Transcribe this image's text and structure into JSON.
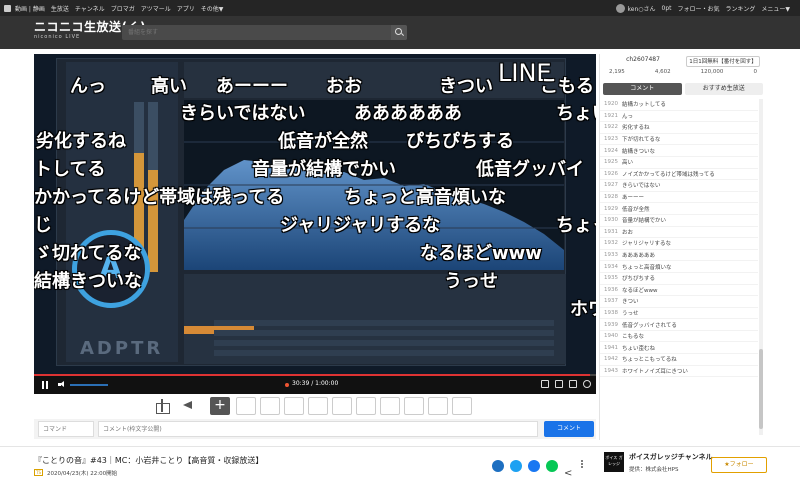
{
  "topbar": {
    "nav": [
      "動画 | 静画",
      "生放送",
      "チャンネル",
      "ブロマガ",
      "アツマール",
      "アプリ",
      "その他▼"
    ],
    "user": "ken○さん",
    "points": "0pt",
    "right_links": [
      "フォロー・お気",
      "ランキング",
      "メニュー▼"
    ]
  },
  "header": {
    "logo_main": "ニコニコ生放送(く)",
    "logo_sub": "niconico LIVE",
    "search_placeholder": "番組を探す"
  },
  "danmaku": [
    "んっ",
    "高い",
    "あーーー",
    "おお",
    "きつい",
    "LINE",
    "こもる",
    "きらいではない",
    "ああああああ",
    "ちょい",
    "劣化するね",
    "低音が全然",
    "ぴちぴちする",
    "トしてる",
    "音量が結構でかい",
    "低音グッバイ",
    "かかってるけど帯域は残ってる",
    "ちょっと高音煩いな",
    "じ",
    "ジャリジャリするな",
    "ちょっ",
    "ゞ切れてるな",
    "なるほどwww",
    "結構きついな",
    "うっせ",
    "ホワ"
  ],
  "player": {
    "time": "30:39 / 1:00:00"
  },
  "comment_input": {
    "command_placeholder": "コマンド",
    "comment_placeholder": "コメント(枠文字公開)",
    "send_label": "コメント"
  },
  "right_panel": {
    "channel_id": "ch2607487",
    "ad_label": "1日1回無料【番付を回す】",
    "stats": [
      "2,195",
      "4,602",
      "120,000",
      "0"
    ],
    "tabs": [
      "コメント",
      "おすすめ生放送"
    ],
    "comments": [
      {
        "no": "1920",
        "text": "結構カットしてる"
      },
      {
        "no": "1921",
        "text": "んっ"
      },
      {
        "no": "1922",
        "text": "劣化するね"
      },
      {
        "no": "1923",
        "text": "下が切れてるな"
      },
      {
        "no": "1924",
        "text": "結構きついな"
      },
      {
        "no": "1925",
        "text": "高い"
      },
      {
        "no": "1926",
        "text": "ノイズかかってるけど帯域は残ってる"
      },
      {
        "no": "1927",
        "text": "きらいではない"
      },
      {
        "no": "1928",
        "text": "あーーー"
      },
      {
        "no": "1929",
        "text": "低音が全然"
      },
      {
        "no": "1930",
        "text": "音量が結構でかい"
      },
      {
        "no": "1931",
        "text": "おお"
      },
      {
        "no": "1932",
        "text": "ジャリジャリするな"
      },
      {
        "no": "1933",
        "text": "ああああああ"
      },
      {
        "no": "1934",
        "text": "ちょっと高音煩いな"
      },
      {
        "no": "1935",
        "text": "ぴちぴちする"
      },
      {
        "no": "1936",
        "text": "なるほどwww"
      },
      {
        "no": "1937",
        "text": "きつい"
      },
      {
        "no": "1938",
        "text": "うっせ"
      },
      {
        "no": "1939",
        "text": "低音グッバイされてる"
      },
      {
        "no": "1940",
        "text": "こもるな"
      },
      {
        "no": "1941",
        "text": "ちょい歪むね"
      },
      {
        "no": "1942",
        "text": "ちょっとこもってるね"
      },
      {
        "no": "1943",
        "text": "ホワイトノイズ耳にきつい"
      }
    ]
  },
  "program": {
    "title": "『ことりの音』#43｜MC：小岩井ことり【高音質・収録放送】",
    "badge": "TS",
    "date": "2020/04/23(木) 22:00開始",
    "channel_name": "ボイスガレッジチャンネル",
    "channel_owner": "提供：株式会社HPS",
    "channel_logo": "ボイス ガレッジ",
    "follow_label": "★フォロー"
  },
  "colors": {
    "accent_blue": "#1a73e8",
    "follow_gold": "#e2a000",
    "spectrum_blue": "#3a7bc8",
    "meter_orange": "#d4963a"
  }
}
